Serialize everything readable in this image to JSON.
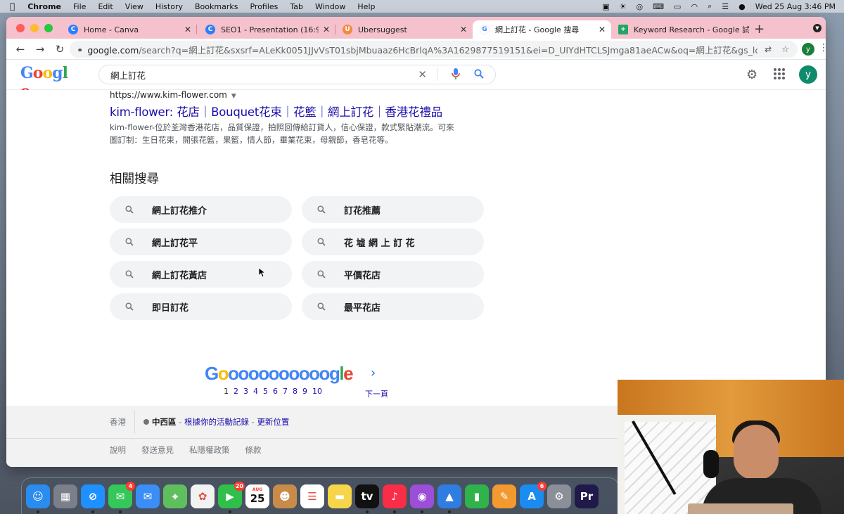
{
  "menubar": {
    "app": "Chrome",
    "items": [
      "File",
      "Edit",
      "View",
      "History",
      "Bookmarks",
      "Profiles",
      "Tab",
      "Window",
      "Help"
    ],
    "datetime": "Wed 25 Aug  3:46 PM"
  },
  "tabs": [
    {
      "label": "Home - Canva",
      "favicon_color": "#2d7ff9",
      "favicon_glyph": "C"
    },
    {
      "label": "SEO1 - Presentation (16:9)",
      "favicon_color": "#2d7ff9",
      "favicon_glyph": "C"
    },
    {
      "label": "Ubersuggest",
      "favicon_color": "#f08b3b",
      "favicon_glyph": "U"
    },
    {
      "label": "網上訂花 - Google 搜尋",
      "favicon_color": "#ffffff",
      "favicon_glyph": "G"
    },
    {
      "label": "Keyword Research - Google 試",
      "favicon_color": "#23a566",
      "favicon_glyph": "+"
    }
  ],
  "toolbar": {
    "url_domain": "google.com",
    "url_rest": "/search?q=網上訂花&sxsrf=ALeKk0051JJvVsT01sbjMbuaaz6HcBrlqA%3A1629877519151&ei=D_UIYdHTCLSJmga81aeACw&oq=網上訂花&gs_lcp=Cgdnd3Mtd2l6...",
    "profile_initial": "y"
  },
  "google": {
    "query": "網上訂花",
    "avatar_initial": "y"
  },
  "result": {
    "cite": "https://www.kim-flower.com",
    "title": "kim-flower: 花店｜Bouquet花束｜花籃｜網上訂花｜香港花禮品",
    "snippet": "kim-flower-位於荃灣香港花店，品質保證，拍照回傳給訂貨人，信心保證，款式緊貼潮流。可來圖訂制：生日花束，開張花籃，果籃，情人節，畢業花束，母親節，香皂花等。"
  },
  "related": {
    "heading": "相關搜尋",
    "items": [
      "網上訂花推介",
      "訂花推薦",
      "網上訂花平",
      "花 墟 網 上 訂 花",
      "網上訂花黃店",
      "平價花店",
      "即日訂花",
      "最平花店"
    ]
  },
  "pagination": {
    "current": "1",
    "pages": [
      "2",
      "3",
      "4",
      "5",
      "6",
      "7",
      "8",
      "9",
      "10"
    ],
    "next_label": "下一頁"
  },
  "footer": {
    "region": "香港",
    "area": "中西區",
    "activity_link": "根據你的活動記錄",
    "update_link": "更新位置",
    "links": [
      "說明",
      "發送意見",
      "私隱權政策",
      "條款"
    ]
  },
  "dock": {
    "icons": [
      {
        "name": "finder",
        "color": "#2b8cf0",
        "glyph": "☺"
      },
      {
        "name": "launchpad",
        "color": "#7a7f8a",
        "glyph": "▦"
      },
      {
        "name": "safari",
        "color": "#1e90ff",
        "glyph": "⊘"
      },
      {
        "name": "messages",
        "color": "#34c759",
        "glyph": "✉",
        "badge": "4"
      },
      {
        "name": "mail",
        "color": "#3a8ef6",
        "glyph": "✉"
      },
      {
        "name": "maps",
        "color": "#5fbf5f",
        "glyph": "⌖"
      },
      {
        "name": "photos",
        "color": "#f2f2f2",
        "glyph": "✿"
      },
      {
        "name": "facetime",
        "color": "#2fbf4a",
        "glyph": "▶",
        "badge": "20"
      },
      {
        "name": "calendar",
        "color": "#ffffff",
        "glyph": "25",
        "month": "AUG"
      },
      {
        "name": "contacts",
        "color": "#c98b4a",
        "glyph": "☻"
      },
      {
        "name": "reminders",
        "color": "#ffffff",
        "glyph": "☰"
      },
      {
        "name": "notes",
        "color": "#f7d54b",
        "glyph": "▬"
      },
      {
        "name": "tv",
        "color": "#111111",
        "glyph": "tv"
      },
      {
        "name": "music",
        "color": "#fa2d48",
        "glyph": "♪"
      },
      {
        "name": "podcasts",
        "color": "#9a4fd6",
        "glyph": "◉"
      },
      {
        "name": "keynote",
        "color": "#2f7de1",
        "glyph": "▲"
      },
      {
        "name": "numbers",
        "color": "#2fb34a",
        "glyph": "▮"
      },
      {
        "name": "pages",
        "color": "#f29a2f",
        "glyph": "✎"
      },
      {
        "name": "app-store",
        "color": "#1a8cf0",
        "glyph": "A",
        "badge": "6"
      },
      {
        "name": "system-preferences",
        "color": "#8a8f98",
        "glyph": "⚙"
      },
      {
        "name": "premiere",
        "color": "#1f1a4a",
        "glyph": "Pr"
      }
    ]
  }
}
